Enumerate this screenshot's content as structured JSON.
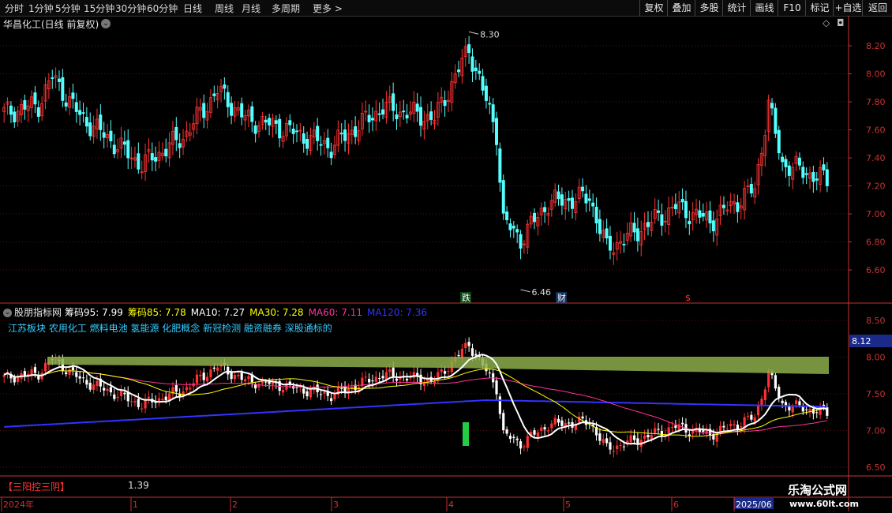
{
  "toolbar": {
    "periods": [
      "分时",
      "1分钟",
      "5分钟",
      "15分钟",
      "30分钟",
      "60分钟",
      "日线",
      "周线",
      "月线",
      "多周期",
      "更多"
    ],
    "right_buttons": [
      "复权",
      "叠加",
      "多股",
      "统计",
      "画线",
      "F10",
      "标记",
      "+自选",
      "返回"
    ]
  },
  "main_chart": {
    "title": "华昌化工(日线 前复权)",
    "y_ticks": [
      "8.20",
      "8.00",
      "7.80",
      "7.60",
      "7.40",
      "7.20",
      "7.00",
      "6.80",
      "6.60"
    ],
    "high_label": "8.30",
    "low_label": "6.46",
    "markers": [
      "跌",
      "财",
      "$"
    ]
  },
  "indicator": {
    "name": "股朋指标网",
    "items": [
      {
        "label": "筹码95: 7.99",
        "color": "#ffffff"
      },
      {
        "label": "筹码85: 7.78",
        "color": "#ffff00"
      },
      {
        "label": "MA10: 7.27",
        "color": "#ffffff"
      },
      {
        "label": "MA30: 7.28",
        "color": "#ffff00"
      },
      {
        "label": "MA60: 7.11",
        "color": "#ff3399"
      },
      {
        "label": "MA120: 7.36",
        "color": "#3333ff"
      }
    ],
    "concepts": "江苏板块 农用化工 燃料电池 氢能源 化肥概念 新冠检测 融资融券 深股通标的",
    "y_ticks": [
      "8.50",
      "8.00",
      "7.50",
      "7.00",
      "6.50"
    ],
    "current_price": "8.12"
  },
  "bottom": {
    "indicator_name": "【三阳控三阴】",
    "value": "1.39"
  },
  "time_axis": {
    "labels": [
      "2024年",
      "1",
      "2",
      "3",
      "4",
      "5",
      "6",
      "2025/06"
    ]
  },
  "watermark": {
    "name": "乐淘公式网",
    "url": "www.60lt.com"
  },
  "colors": {
    "up": "#ff3232",
    "down": "#54ffff",
    "ma10": "#ffffff",
    "ma30": "#ffff00",
    "ma60": "#ff3399",
    "ma120": "#3333ff",
    "chip_band": "#8cad4a",
    "axis": "#c83232"
  }
}
